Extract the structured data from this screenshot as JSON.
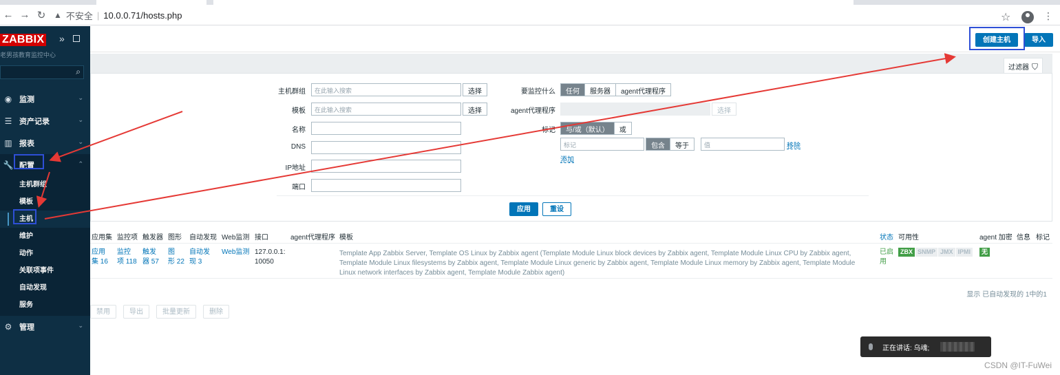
{
  "browser": {
    "security_label": "不安全",
    "url": "10.0.0.71/hosts.php"
  },
  "sidebar": {
    "brand": "ZABBIX",
    "server_name": "老男孩教育监控中心",
    "menu": [
      {
        "label": "监测",
        "icon": "eye-icon"
      },
      {
        "label": "资产记录",
        "icon": "list-icon"
      },
      {
        "label": "报表",
        "icon": "bar-chart-icon"
      },
      {
        "label": "配置",
        "icon": "wrench-icon"
      }
    ],
    "submenu": [
      "主机群组",
      "模板",
      "主机",
      "维护",
      "动作",
      "关联项事件",
      "自动发现",
      "服务"
    ],
    "admin": {
      "label": "管理",
      "icon": "gear-icon"
    }
  },
  "header": {
    "create_host": "创建主机",
    "import": "导入"
  },
  "filter": {
    "tab_label": "过滤器",
    "host_groups_label": "主机群组",
    "host_groups_placeholder": "在此输入搜索",
    "templates_label": "模板",
    "templates_placeholder": "在此输入搜索",
    "select_btn": "选择",
    "name_label": "名称",
    "dns_label": "DNS",
    "ip_label": "IP地址",
    "port_label": "端口",
    "monitored_by_label": "要监控什么",
    "monitored_by": [
      "任何",
      "服务器",
      "agent代理程序"
    ],
    "proxy_label": "agent代理程序",
    "tags_label": "标记",
    "tags_mode": [
      "与/或（默认）",
      "或"
    ],
    "tag_placeholder": "标记",
    "tag_ops": [
      "包含",
      "等于"
    ],
    "value_placeholder": "值",
    "remove": "移除",
    "add": "添加",
    "apply": "应用",
    "reset": "重设"
  },
  "table": {
    "headers": [
      "应用集",
      "监控项",
      "触发器",
      "图形",
      "自动发现",
      "Web监测",
      "接口",
      "agent代理程序",
      "模板",
      "状态",
      "可用性",
      "agent 加密",
      "信息",
      "标记"
    ],
    "row": {
      "applications": [
        "应用",
        "集 16"
      ],
      "items": [
        "监控",
        "项 118"
      ],
      "triggers": [
        "触发",
        "器 57"
      ],
      "graphs": [
        "图",
        "形 22"
      ],
      "discovery": [
        "自动发",
        "现 3"
      ],
      "web": "Web监测",
      "interface": [
        "127.0.0.1:",
        "10050"
      ],
      "templates": "Template App Zabbix Server, Template OS Linux by Zabbix agent (Template Module Linux block devices by Zabbix agent, Template Module Linux CPU by Zabbix agent, Template Module Linux filesystems by Zabbix agent, Template Module Linux generic by Zabbix agent, Template Module Linux memory by Zabbix agent, Template Module Linux network interfaces by Zabbix agent, Template Module Zabbix agent)",
      "status": [
        "已启",
        "用"
      ],
      "availability": [
        "ZBX",
        "SNMP",
        "JMX",
        "IPMI"
      ],
      "encryption": "无"
    },
    "footer": "显示 已自动发现的 1中的1"
  },
  "actions": [
    "禁用",
    "导出",
    "批量更新",
    "删除"
  ],
  "toast": {
    "text": "正在讲话: 乌魂;"
  },
  "watermark": "CSDN @IT-FuWei"
}
